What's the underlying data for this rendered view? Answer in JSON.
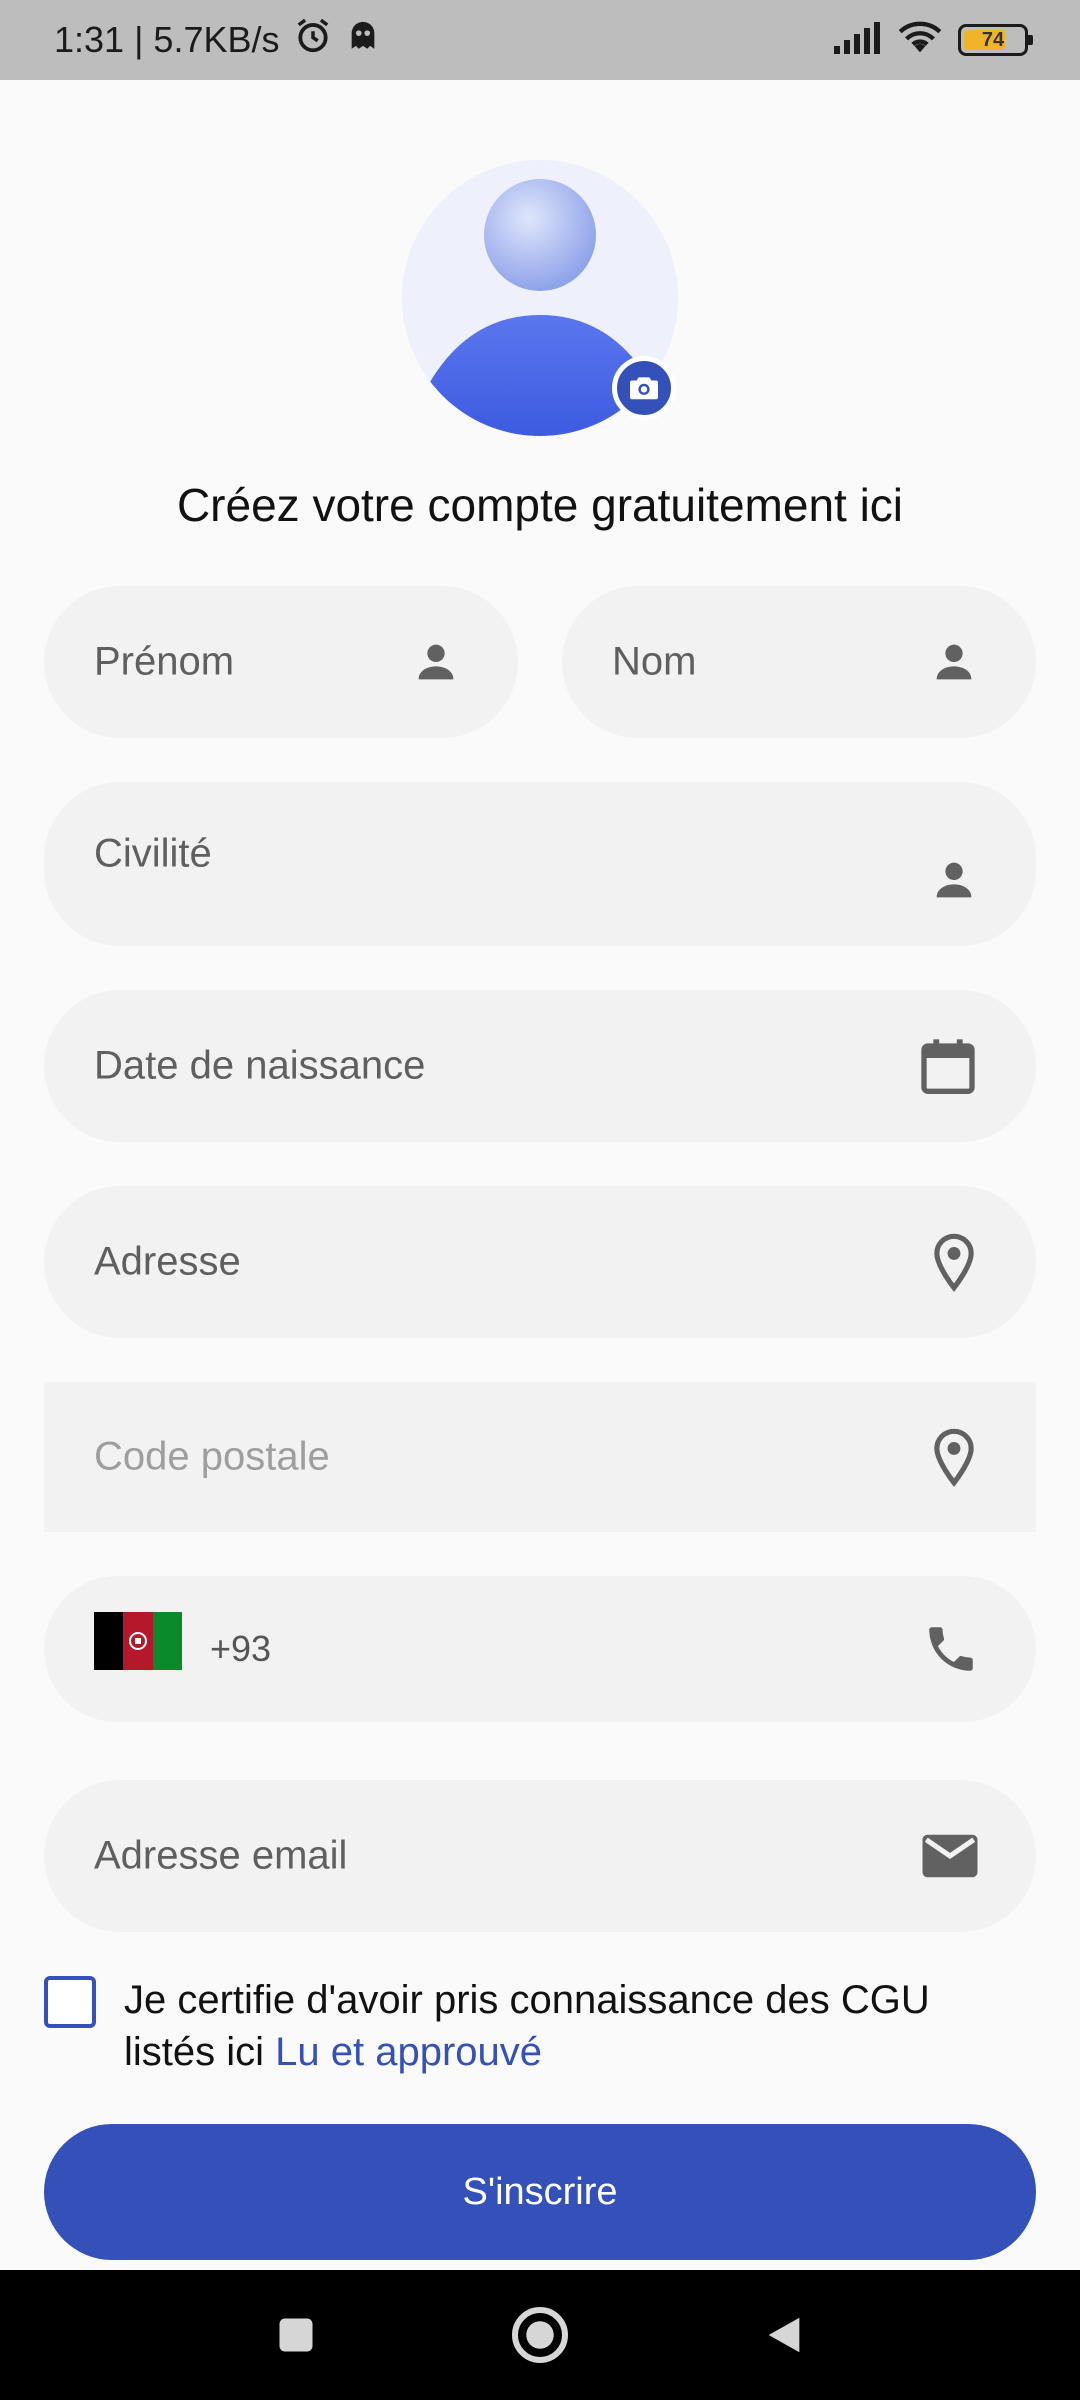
{
  "status_bar": {
    "time_speed": "1:31 | 5.7KB/s",
    "battery_level": "74",
    "icons": [
      "alarm-icon",
      "ghost-icon",
      "signal-icon",
      "wifi-icon",
      "battery-icon"
    ]
  },
  "header": {
    "title": "Créez votre compte gratuitement ici"
  },
  "form": {
    "first_name_placeholder": "Prénom",
    "last_name_placeholder": "Nom",
    "civility_placeholder": "Civilité",
    "birthdate_placeholder": "Date de naissance",
    "address_placeholder": "Adresse",
    "postal_code_placeholder": "Code postale",
    "phone_code": "+93",
    "email_placeholder": "Adresse email",
    "cgu_text": "Je certifie d'avoir pris connaissance des CGU listés ici ",
    "cgu_link": "Lu et approuvé",
    "submit_label": "S'inscrire"
  },
  "colors": {
    "accent": "#3451b9",
    "field_bg": "#f2f2f2",
    "icon": "#616161"
  }
}
